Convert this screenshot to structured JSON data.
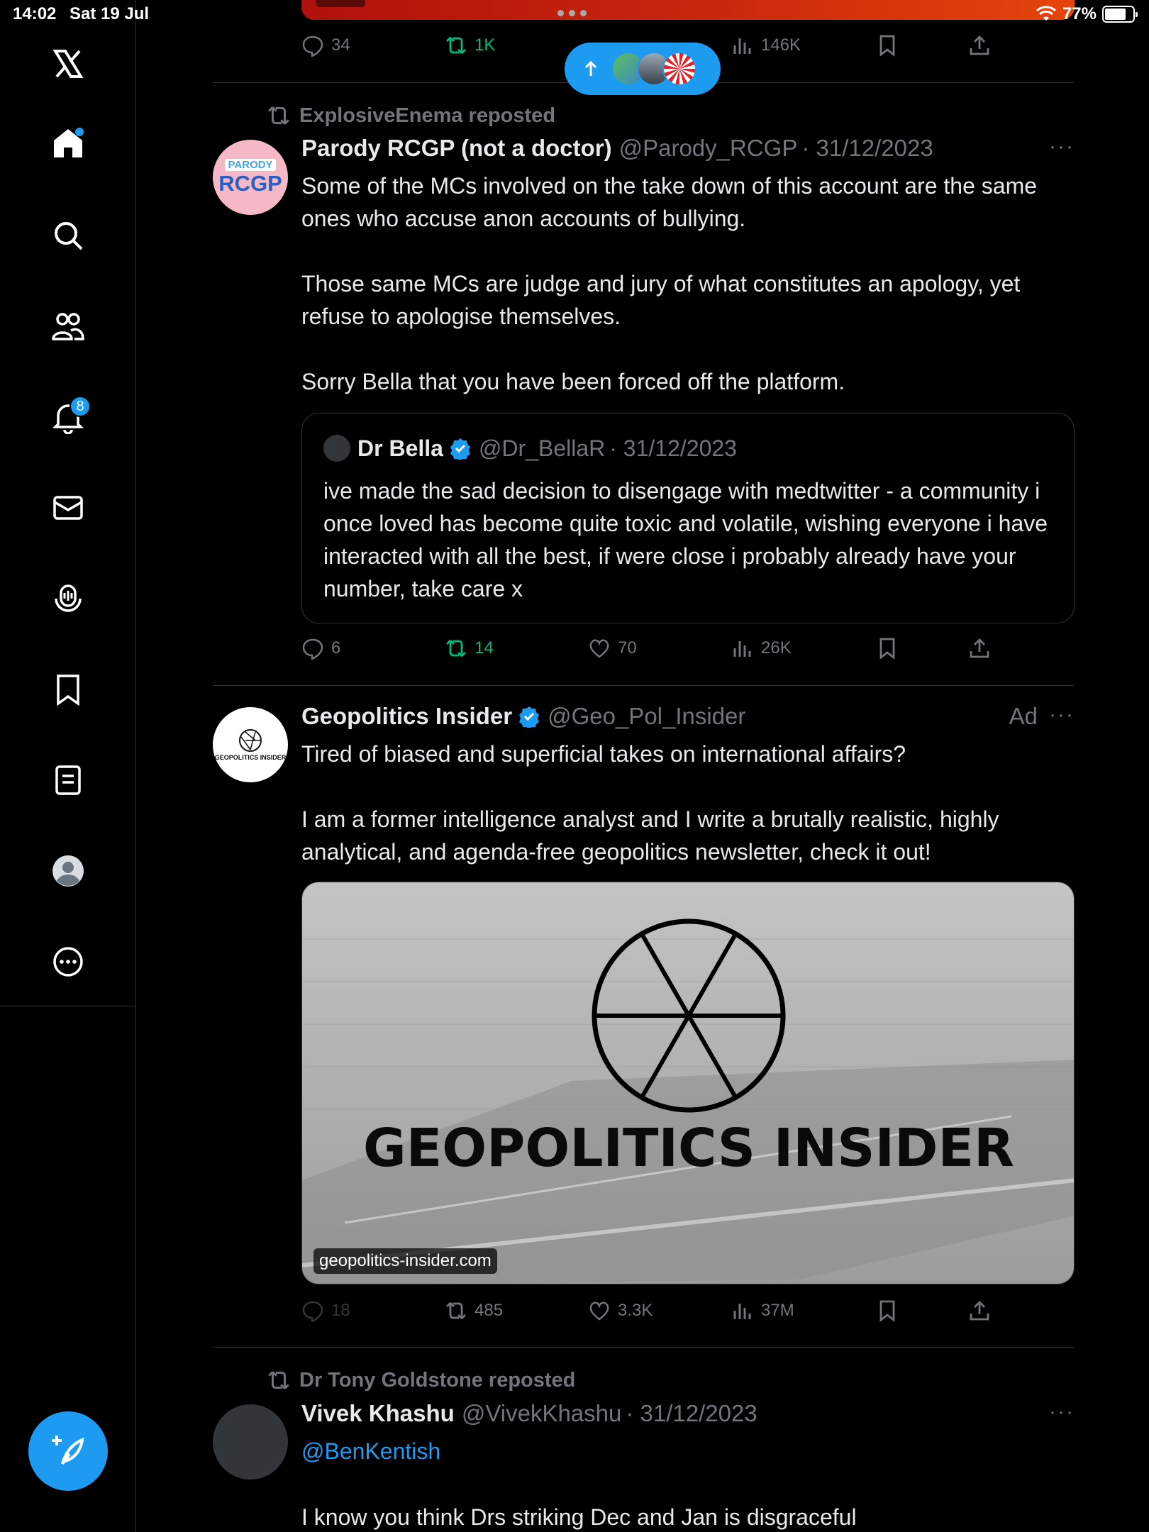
{
  "status_bar": {
    "time": "14:02",
    "date": "Sat 19 Jul",
    "battery": "77%"
  },
  "sidebar": {
    "items": [
      {
        "name": "home",
        "icon": "home-icon"
      },
      {
        "name": "search",
        "icon": "search-icon"
      },
      {
        "name": "communities",
        "icon": "people-icon"
      },
      {
        "name": "notifications",
        "icon": "bell-icon",
        "badge": "8"
      },
      {
        "name": "messages",
        "icon": "mail-icon"
      },
      {
        "name": "spaces",
        "icon": "microphone-icon"
      },
      {
        "name": "bookmarks",
        "icon": "bookmark-icon"
      },
      {
        "name": "lists",
        "icon": "list-icon"
      },
      {
        "name": "profile",
        "icon": "profile-icon"
      },
      {
        "name": "more",
        "icon": "more-icon"
      }
    ]
  },
  "top_tweet": {
    "replies": "34",
    "reposts": "1K",
    "views": "146K"
  },
  "tweet1": {
    "reposted_by": "ExplosiveEnema reposted",
    "avatar_text_top": "PARODY",
    "avatar_text_main": "RCGP",
    "name": "Parody RCGP (not a doctor)",
    "handle": "@Parody_RCGP",
    "date": "· 31/12/2023",
    "text": "Some of the MCs involved on the take down of this account are the same ones who accuse anon accounts of bullying.\n\nThose same MCs are judge and jury of what constitutes an apology, yet refuse to apologise themselves.\n\nSorry Bella that you have been forced off the platform.",
    "quote": {
      "name": "Dr Bella",
      "handle": "@Dr_BellaR",
      "date": "· 31/12/2023",
      "text": "ive made the sad decision to disengage with medtwitter - a community i once loved has become quite toxic and volatile, wishing everyone i have interacted with all the best, if were close i probably already have your number, take care x"
    },
    "replies": "6",
    "reposts": "14",
    "likes": "70",
    "views": "26K"
  },
  "tweet2": {
    "name": "Geopolitics Insider",
    "handle": "@Geo_Pol_Insider",
    "ad_label": "Ad",
    "avatar_text": "GEOPOLITICS INSIDER",
    "text": "Tired of biased and superficial takes on international affairs?\n\nI am a former intelligence analyst and I write a brutally realistic, highly analytical, and agenda-free geopolitics newsletter, check it out!",
    "media_title": "GEOPOLITICS INSIDER",
    "media_domain": "geopolitics-insider.com",
    "replies": "18",
    "reposts": "485",
    "likes": "3.3K",
    "views": "37M"
  },
  "tweet3": {
    "reposted_by": "Dr Tony Goldstone reposted",
    "name": "Vivek Khashu",
    "handle": "@VivekKhashu",
    "date": "· 31/12/2023",
    "mention": "@BenKentish",
    "text": "I know you think Drs striking Dec and Jan is disgraceful"
  },
  "more_label": "···",
  "colors": {
    "accent": "#1d9bf0",
    "repost_green": "#00ba7c",
    "muted": "#71767b",
    "border": "#2f3336"
  }
}
